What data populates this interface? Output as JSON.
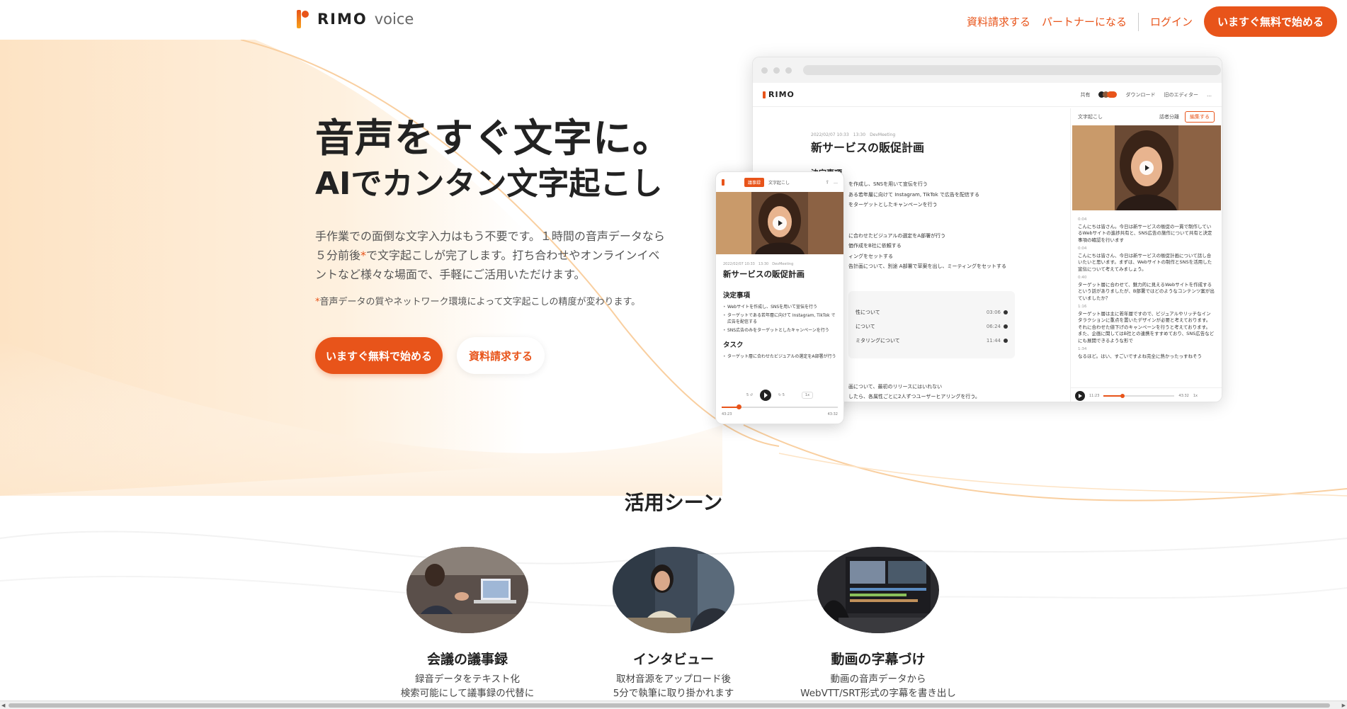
{
  "header": {
    "logo_word": "RIMO",
    "logo_sub": "voice",
    "nav": [
      {
        "label": "資料請求する"
      },
      {
        "label": "パートナーになる"
      },
      {
        "label": "ログイン"
      }
    ],
    "cta": "いますぐ無料で始める"
  },
  "hero": {
    "title": "音声をすぐ文字に。",
    "subtitle": "AIでカンタン文字起こし",
    "desc_1": "手作業での面倒な文字入力はもう不要です。１時間の音声データなら５分前後",
    "desc_ast": "*",
    "desc_2": "で文字起こしが完了します。打ち合わせやオンラインイベ ントなど様々な場面で、手軽にご活用いただけます。",
    "note_ast": "*",
    "note": "音声データの質やネットワーク環境によって文字起こしの精度が変わります。",
    "primary_btn": "いますぐ無料で始める",
    "secondary_btn": "資料請求する"
  },
  "desktop_mock": {
    "logo": "RIMO",
    "tools": [
      "共有",
      "ダウンロード",
      "旧のエディター",
      "…"
    ],
    "meta": "2022/02/07 10:33　13:30　DevMeeting",
    "title": "新サービスの販促計画",
    "section": "決定事項",
    "lines": [
      "を作成し、SNSを用いて宣伝を行う",
      "ある若年層に向けて Instagram, TikTok で広告を配信する",
      "をターゲットとしたキャンペーンを行う",
      "",
      "",
      "に合わせたビジュアルの選定をA部署が行う",
      "価作成をB社に依頼する",
      "ィングをセットする",
      "告計画について、別途 A部署で草案を出し、ミーティングをセットする"
    ],
    "card_rows": [
      {
        "label": "性について",
        "time": "03:06"
      },
      {
        "label": "について",
        "time": "06:24"
      },
      {
        "label": "ミタリングについて",
        "time": "11:44"
      }
    ],
    "bottom_lines": [
      "画について、最初のリリースにはいれない",
      "したら、各属性ごとに2人ずつユーザーヒアリングを行う。"
    ],
    "right_label": "文字起こし",
    "right_opt": "話者分離",
    "edit_btn": "編集する",
    "transcript": [
      {
        "ts": "0:04",
        "text": "こんにちは皆さん。今日は新サービスの販促の一貫で制作しているWebサイトの進捗共有と、SNS広告の施作について共有と決定事項の確認を行います"
      },
      {
        "ts": "0:04",
        "text": "こんにちは皆さん、今日は新サービスの販促計画について話し合いたいと思います。まずは、Webサイトの制作とSNSを活用した宣伝について考えてみましょう。"
      },
      {
        "ts": "0:40",
        "text": "ターゲット層に合わせて、魅力的に見えるWebサイトを作成するという話がありましたが、B部署ではどのようなコンテンツ案が出ていましたか？"
      },
      {
        "ts": "1:16",
        "text": "ターゲット層は主に若年層ですので、ビジュアルやリッチなインタラクションに重点を置いたデザインが必要と考えております。それに合わせた値下げのキャンペーンを行うと考えております。また、企画に関してはB社との連携をすすめており、SNS広告などにも展開できるような形で"
      },
      {
        "ts": "1:34",
        "text": "なるほど。はい、すごいですよね完全に熱かったっすねそう"
      }
    ],
    "time_start": "11:23",
    "time_end": "43:32",
    "speed": "1x"
  },
  "mobile_mock": {
    "tab_active": "議事録",
    "tab_other": "文字起こし",
    "meta": "2022/02/07 10:33　13:30　DevMeeting",
    "title": "新サービスの販促計画",
    "section1": "決定事項",
    "items": [
      "Webサイトを作成し、SNSを用いて宣伝を行う",
      "ターゲットである若年層に向けて Instagram, TikTok で広告を配信する",
      "SNS広告のみをターゲットとしたキャンペーンを行う"
    ],
    "section2": "タスク",
    "task": "ターゲット層に合わせたビジュアルの選定をA部署が行う",
    "skip_back": "5",
    "skip_fwd": "5",
    "speed": "1x",
    "time_start": "43:23",
    "time_end": "43:32"
  },
  "scenes": {
    "title": "活用シーン",
    "items": [
      {
        "name": "会議の議事録",
        "desc_1": "録音データをテキスト化",
        "desc_2": "検索可能にして議事録の代替に"
      },
      {
        "name": "インタビュー",
        "desc_1": "取材音源をアップロード後",
        "desc_2": "5分で執筆に取り掛かれます"
      },
      {
        "name": "動画の字幕づけ",
        "desc_1": "動画の音声データから",
        "desc_2": "WebVTT/SRT形式の字幕を書き出し"
      }
    ]
  },
  "colors": {
    "accent": "#e8541a",
    "peach": "#fde3c4"
  }
}
